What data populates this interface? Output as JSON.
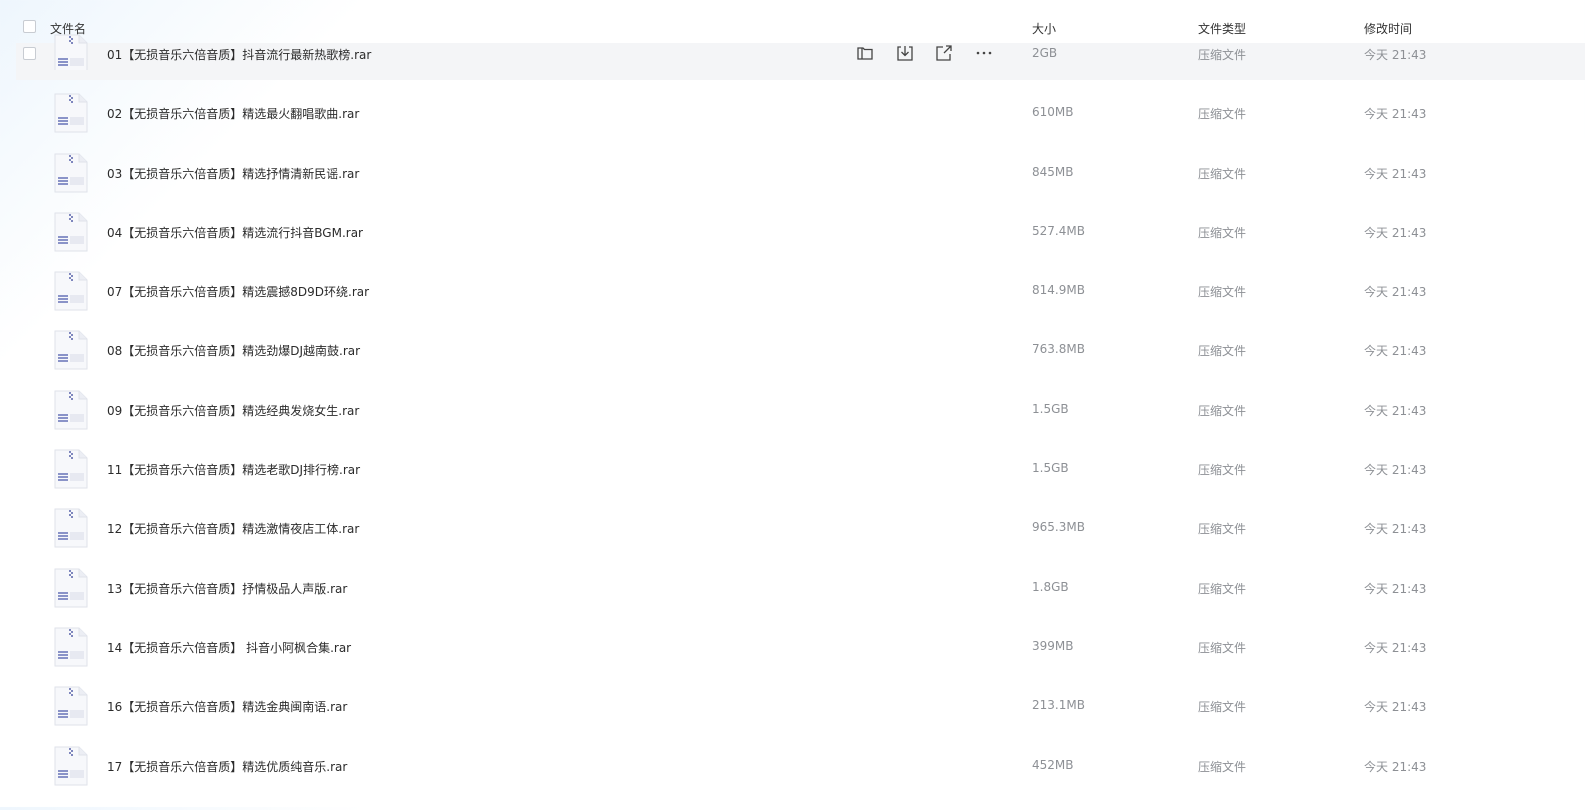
{
  "header": {
    "name": "文件名",
    "size": "大小",
    "type": "文件类型",
    "time": "修改时间"
  },
  "files": [
    {
      "name": "01【无损音乐六倍音质】抖音流行最新热歌榜.rar",
      "size": "2GB",
      "type": "压缩文件",
      "time": "今天 21:43"
    },
    {
      "name": "02【无损音乐六倍音质】精选最火翻唱歌曲.rar",
      "size": "610MB",
      "type": "压缩文件",
      "time": "今天 21:43"
    },
    {
      "name": "03【无损音乐六倍音质】精选抒情清新民谣.rar",
      "size": "845MB",
      "type": "压缩文件",
      "time": "今天 21:43"
    },
    {
      "name": "04【无损音乐六倍音质】精选流行抖音BGM.rar",
      "size": "527.4MB",
      "type": "压缩文件",
      "time": "今天 21:43"
    },
    {
      "name": "07【无损音乐六倍音质】精选震撼8D9D环绕.rar",
      "size": "814.9MB",
      "type": "压缩文件",
      "time": "今天 21:43"
    },
    {
      "name": "08【无损音乐六倍音质】精选劲爆DJ越南鼓.rar",
      "size": "763.8MB",
      "type": "压缩文件",
      "time": "今天 21:43"
    },
    {
      "name": "09【无损音乐六倍音质】精选经典发烧女生.rar",
      "size": "1.5GB",
      "type": "压缩文件",
      "time": "今天 21:43"
    },
    {
      "name": "11【无损音乐六倍音质】精选老歌DJ排行榜.rar",
      "size": "1.5GB",
      "type": "压缩文件",
      "time": "今天 21:43"
    },
    {
      "name": "12【无损音乐六倍音质】精选激情夜店工体.rar",
      "size": "965.3MB",
      "type": "压缩文件",
      "time": "今天 21:43"
    },
    {
      "name": "13【无损音乐六倍音质】抒情极品人声版.rar",
      "size": "1.8GB",
      "type": "压缩文件",
      "time": "今天 21:43"
    },
    {
      "name": "14【无损音乐六倍音质】 抖音小阿枫合集.rar",
      "size": "399MB",
      "type": "压缩文件",
      "time": "今天 21:43"
    },
    {
      "name": "16【无损音乐六倍音质】精选金典闽南语.rar",
      "size": "213.1MB",
      "type": "压缩文件",
      "time": "今天 21:43"
    },
    {
      "name": "17【无损音乐六倍音质】精选优质纯音乐.rar",
      "size": "452MB",
      "type": "压缩文件",
      "time": "今天 21:43"
    }
  ],
  "row_actions": [
    "folder-icon",
    "download-icon",
    "share-icon",
    "more-icon"
  ],
  "icon_names": {
    "file": "zip-file-icon"
  },
  "colors": {
    "hover_row": "#f4f5f7",
    "meta_text": "#8d9095",
    "file_icon_stripe": "#8a93c8"
  }
}
